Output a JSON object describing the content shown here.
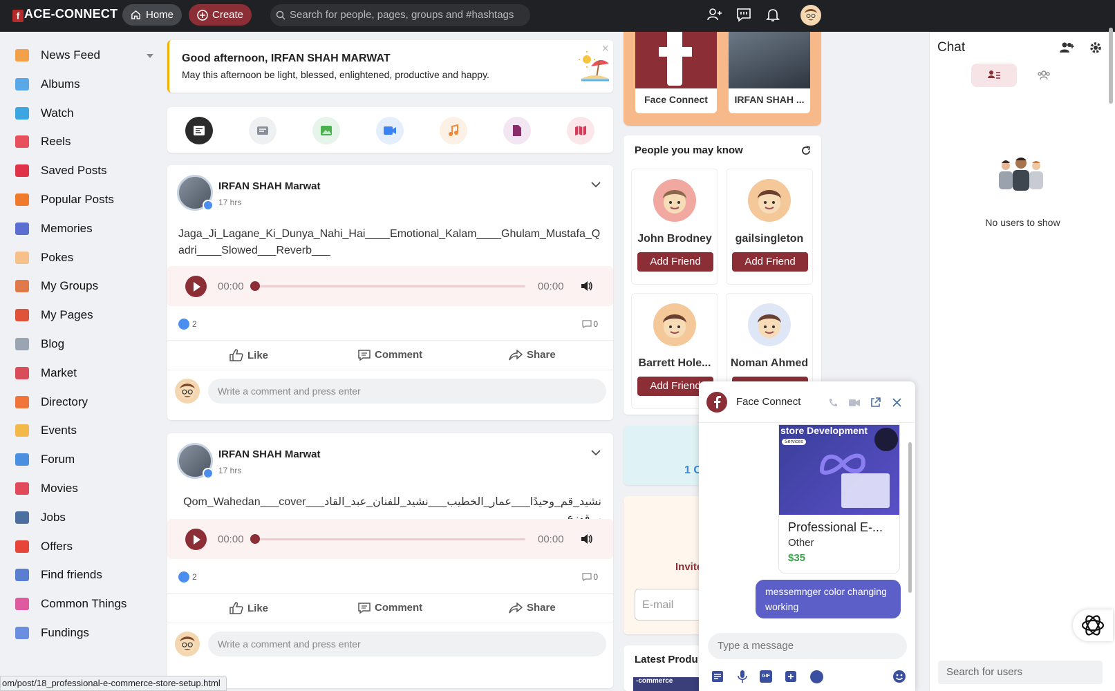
{
  "topbar": {
    "logo": "ACE-CONNECT",
    "home_label": "Home",
    "create_label": "Create",
    "search_placeholder": "Search for people, pages, groups and #hashtags"
  },
  "sidebar": {
    "items": [
      {
        "label": "News Feed",
        "icon": "home-icon",
        "color": "#f2a04a"
      },
      {
        "label": "Albums",
        "icon": "albums-icon",
        "color": "#5aa9e6"
      },
      {
        "label": "Watch",
        "icon": "watch-icon",
        "color": "#3da5e0"
      },
      {
        "label": "Reels",
        "icon": "reels-icon",
        "color": "#e8505b"
      },
      {
        "label": "Saved Posts",
        "icon": "bookmark-icon",
        "color": "#e0334a"
      },
      {
        "label": "Popular Posts",
        "icon": "fire-icon",
        "color": "#f07a2c"
      },
      {
        "label": "Memories",
        "icon": "memories-icon",
        "color": "#5a6fd0"
      },
      {
        "label": "Pokes",
        "icon": "poke-icon",
        "color": "#f5c08a"
      },
      {
        "label": "My Groups",
        "icon": "groups-icon",
        "color": "#e07a4a"
      },
      {
        "label": "My Pages",
        "icon": "flag-icon",
        "color": "#e0533a"
      },
      {
        "label": "Blog",
        "icon": "blog-icon",
        "color": "#9aa5b1"
      },
      {
        "label": "Market",
        "icon": "market-icon",
        "color": "#d94c5a"
      },
      {
        "label": "Directory",
        "icon": "directory-icon",
        "color": "#f0753a"
      },
      {
        "label": "Events",
        "icon": "calendar-icon",
        "color": "#f2b84a"
      },
      {
        "label": "Forum",
        "icon": "forum-icon",
        "color": "#4a8fe0"
      },
      {
        "label": "Movies",
        "icon": "movies-icon",
        "color": "#e04a5a"
      },
      {
        "label": "Jobs",
        "icon": "briefcase-icon",
        "color": "#4a6fa0"
      },
      {
        "label": "Offers",
        "icon": "offers-icon",
        "color": "#e8453a"
      },
      {
        "label": "Find friends",
        "icon": "find-friends-icon",
        "color": "#5a7fd0"
      },
      {
        "label": "Common Things",
        "icon": "puzzle-icon",
        "color": "#e05aa0"
      },
      {
        "label": "Fundings",
        "icon": "fundings-icon",
        "color": "#6a8fe0"
      }
    ]
  },
  "greeting": {
    "title": "Good afternoon, IRFAN SHAH MARWAT",
    "message": "May this afternoon be light, blessed, enlightened, productive and happy."
  },
  "posts": [
    {
      "author": "IRFAN SHAH Marwat",
      "time": "17 hrs",
      "text": "Jaga_Ji_Lagane_Ki_Dunya_Nahi_Hai____Emotional_Kalam____Ghulam_Mustafa_Qadri____Slowed___Reverb___",
      "time_start": "00:00",
      "time_end": "00:00",
      "reactions": "2",
      "comments": "0"
    },
    {
      "author": "IRFAN SHAH Marwat",
      "time": "17 hrs",
      "text": "Qom_Wahedan___cover___نشيد_قم_وحيدًا___عمار_الخطيب___نشيد_للفنان_عبد_القادر_قوزع",
      "time_start": "00:00",
      "time_end": "00:00",
      "reactions": "2",
      "comments": "0"
    }
  ],
  "post_actions": {
    "like": "Like",
    "comment": "Comment",
    "share": "Share"
  },
  "comment_placeholder": "Write a comment and press enter",
  "pages_strip": [
    {
      "label": "Face Connect"
    },
    {
      "label": "IRFAN SHAH ..."
    }
  ],
  "people_you_may_know": {
    "title": "People you may know",
    "add_label": "Add Friend",
    "people": [
      {
        "name": "John Brodney"
      },
      {
        "name": "gailsingleton"
      },
      {
        "name": "Barrett Hole..."
      },
      {
        "name": "Noman Ahmed"
      }
    ]
  },
  "partial": {
    "count_fragment": "1 C",
    "invite_fragment": "Invite",
    "email_placeholder": "E-mail",
    "latest_products": "Latest Produ",
    "product_thumb": "-commerce"
  },
  "chat_panel": {
    "title": "Chat",
    "empty": "No users to show",
    "search_placeholder": "Search for users"
  },
  "chat_window": {
    "name": "Face Connect",
    "product_banner": "store Development",
    "product_tag": "Services",
    "product_title": "Professional E-...",
    "product_category": "Other",
    "product_price": "$35",
    "message": "messemnger color changing working",
    "input_placeholder": "Type a message",
    "gif_label": "GIF"
  },
  "status_url": "om/post/18_professional-e-commerce-store-setup.html",
  "colors": {
    "brand": "#8b2e36",
    "topbar": "#202124",
    "accent_blue": "#4a8ff0",
    "price_green": "#3aa34a",
    "bubble": "#5b5fc7"
  }
}
